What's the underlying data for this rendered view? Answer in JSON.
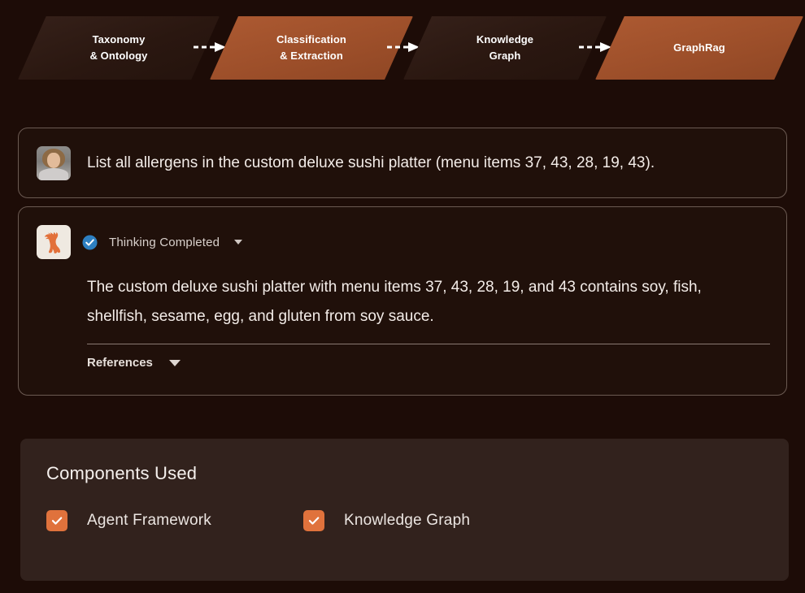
{
  "theme": {
    "background": "#1d0c07",
    "accent": "#e0723c",
    "active_step": "#a8552f",
    "inactive_step": "#2d1a13",
    "panel_bg": "#32221d",
    "card_bg": "#20100a",
    "card_border": "#6b5a52",
    "badge_blue": "#2d7fc1"
  },
  "pipeline": {
    "steps": [
      {
        "label": "Taxonomy\n& Ontology",
        "state": "inactive"
      },
      {
        "label": "Classification\n& Extraction",
        "state": "active"
      },
      {
        "label": "Knowledge\nGraph",
        "state": "inactive"
      },
      {
        "label": "GraphRag",
        "state": "active"
      }
    ],
    "connector": "dashed-arrow-right"
  },
  "conversation": {
    "user": {
      "avatar": "user-photo-avatar",
      "message": "List all allergens in the custom deluxe sushi platter (menu items 37, 43, 28, 19, 43)."
    },
    "assistant": {
      "avatar": "squirrel-logo-avatar",
      "status_icon": "check-circle-icon",
      "status_label": "Thinking Completed",
      "status_caret": "chevron-down-icon",
      "message": "The custom deluxe sushi platter with menu items 37, 43, 28, 19, and 43 contains soy, fish, shellfish, sesame, egg, and gluten from soy sauce.",
      "references_label": "References",
      "references_caret": "chevron-down-icon"
    }
  },
  "components_panel": {
    "title": "Components Used",
    "items": [
      {
        "label": "Agent Framework",
        "checked": true
      },
      {
        "label": "Knowledge Graph",
        "checked": true
      }
    ]
  }
}
